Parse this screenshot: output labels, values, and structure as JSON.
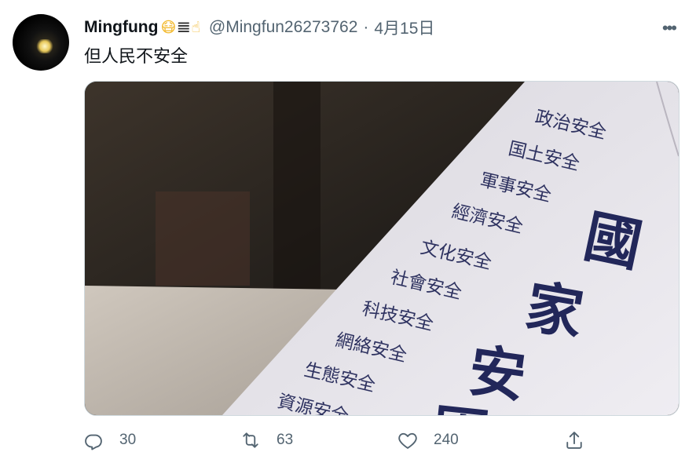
{
  "tweet": {
    "display_name": "Mingfung",
    "name_emojis": [
      "😷",
      "𝌆",
      "☝"
    ],
    "handle": "@Mingfun26273762",
    "separator": "·",
    "date": "4月15日",
    "more_label": "•••",
    "text": "但人民不安全"
  },
  "media": {
    "sign_list": [
      "政治安全",
      "国土安全",
      "軍事安全",
      "經濟安全",
      "文化安全",
      "社會安全",
      "科技安全",
      "網絡安全",
      "生態安全",
      "資源安全"
    ],
    "big_chars": [
      "國",
      "家",
      "安",
      "因"
    ]
  },
  "actions": {
    "reply": {
      "icon": "reply-icon",
      "count": "30"
    },
    "retweet": {
      "icon": "retweet-icon",
      "count": "63"
    },
    "like": {
      "icon": "heart-icon",
      "count": "240"
    },
    "share": {
      "icon": "share-icon"
    }
  },
  "colors": {
    "text": "#0f1419",
    "secondary": "#536471",
    "sign_ink": "#2e3260",
    "sign_paper": "#e7e5ea"
  }
}
